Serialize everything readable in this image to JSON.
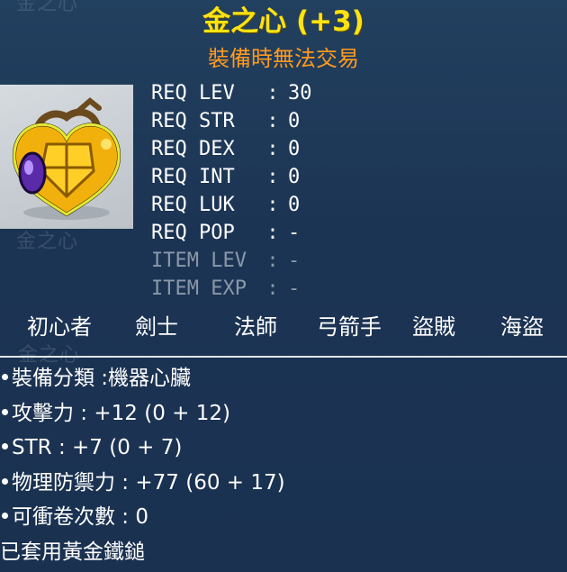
{
  "item": {
    "name": "金之心 (+3)",
    "trade_notice": "裝備時無法交易",
    "icon": "golden-heart-icon",
    "ghost_name": "金之心"
  },
  "requirements": [
    {
      "key": "REQ LEV",
      "sep": ":",
      "value": "30",
      "dim": false
    },
    {
      "key": "REQ STR",
      "sep": ":",
      "value": "0",
      "dim": false
    },
    {
      "key": "REQ DEX",
      "sep": ":",
      "value": "0",
      "dim": false
    },
    {
      "key": "REQ INT",
      "sep": ":",
      "value": "0",
      "dim": false
    },
    {
      "key": "REQ LUK",
      "sep": ":",
      "value": "0",
      "dim": false
    },
    {
      "key": "REQ POP",
      "sep": ":",
      "value": "-",
      "dim": false
    },
    {
      "key": "ITEM LEV",
      "sep": ":",
      "value": "-",
      "dim": true
    },
    {
      "key": "ITEM EXP",
      "sep": ":",
      "value": "-",
      "dim": true
    }
  ],
  "jobs": [
    "初心者",
    "劍士",
    "法師",
    "弓箭手",
    "盜賊",
    "海盜"
  ],
  "stats": [
    {
      "text": "裝備分類 :機器心臟",
      "bullet": true
    },
    {
      "text": "攻擊力 : +12 (0 + 12)",
      "bullet": true
    },
    {
      "text": "STR : +7 (0 + 7)",
      "bullet": true
    },
    {
      "text": "物理防禦力 : +77 (60 + 17)",
      "bullet": true
    },
    {
      "text": "可衝卷次數 : 0",
      "bullet": true
    },
    {
      "text": "已套用黃金鐵鎚",
      "bullet": false
    }
  ],
  "colors": {
    "title": "#ffe311",
    "notice": "#ff9a1e",
    "text": "#ffffff",
    "dim_text": "#8a98a8",
    "background": "#1d3656"
  }
}
